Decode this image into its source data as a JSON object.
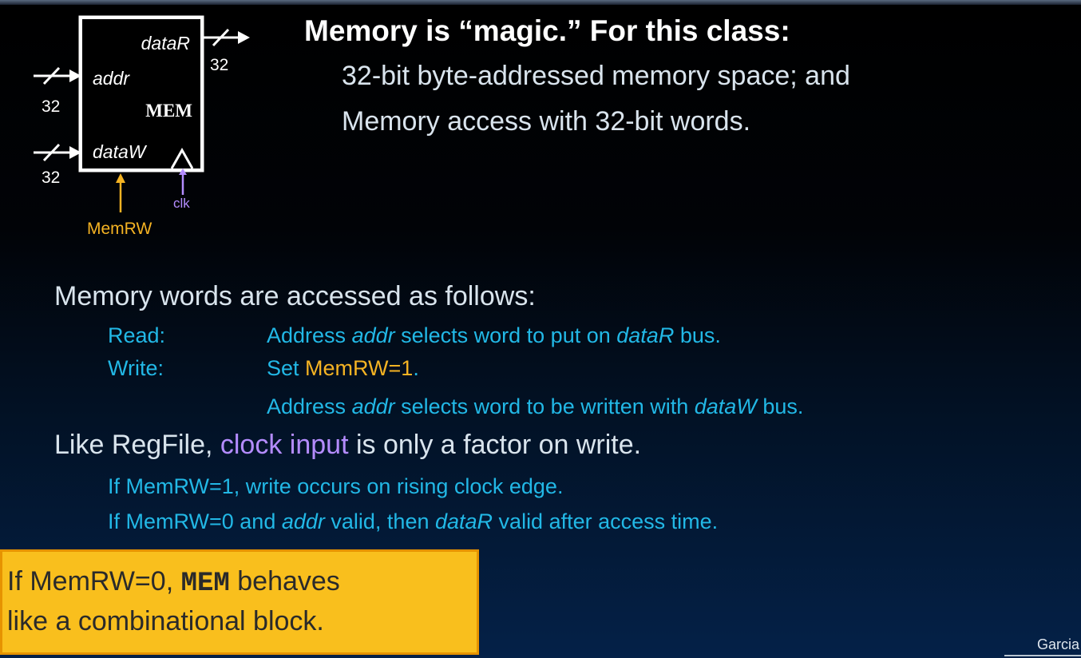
{
  "title": "Memory is “magic.” For this class:",
  "intro_lines": [
    "32-bit byte-addressed memory space; and",
    "Memory access with 32-bit words."
  ],
  "diagram": {
    "block_label": "MEM",
    "port_dataR": "dataR",
    "port_addr": "addr",
    "port_dataW": "dataW",
    "width_dataR": "32",
    "width_addr": "32",
    "width_dataW": "32",
    "clk_label": "clk",
    "memrw_label": "MemRW"
  },
  "access": {
    "heading": "Memory words are accessed as follows:",
    "read_label": "Read:",
    "read_text": [
      "Address ",
      "addr",
      " selects word to put on ",
      "dataR",
      " bus."
    ],
    "write_label": "Write:",
    "write_line1": [
      "Set ",
      "MemRW=1",
      "."
    ],
    "write_line2": [
      "Address ",
      "addr",
      " selects word to be written with ",
      "dataW",
      " bus."
    ]
  },
  "clock": {
    "line": [
      "Like RegFile, ",
      "clock input",
      " is only a factor on write."
    ],
    "if1": "If MemRW=1, write occurs on rising clock edge.",
    "if2": [
      "If MemRW=0 and ",
      "addr",
      " valid, then ",
      "dataR",
      " valid after access time."
    ]
  },
  "callout": {
    "pre": "If MemRW=0, ",
    "mono": "MEM",
    "post": " behaves",
    "line2": "like a combinational block."
  },
  "footer": "Garcia",
  "colors": {
    "title": "#ffffff",
    "body": "#d9e4ed",
    "cyan": "#22b8e6",
    "memrw_orange": "#f5b323",
    "clock_purple": "#b48cff",
    "callout_bg": "#f9bf1d"
  }
}
